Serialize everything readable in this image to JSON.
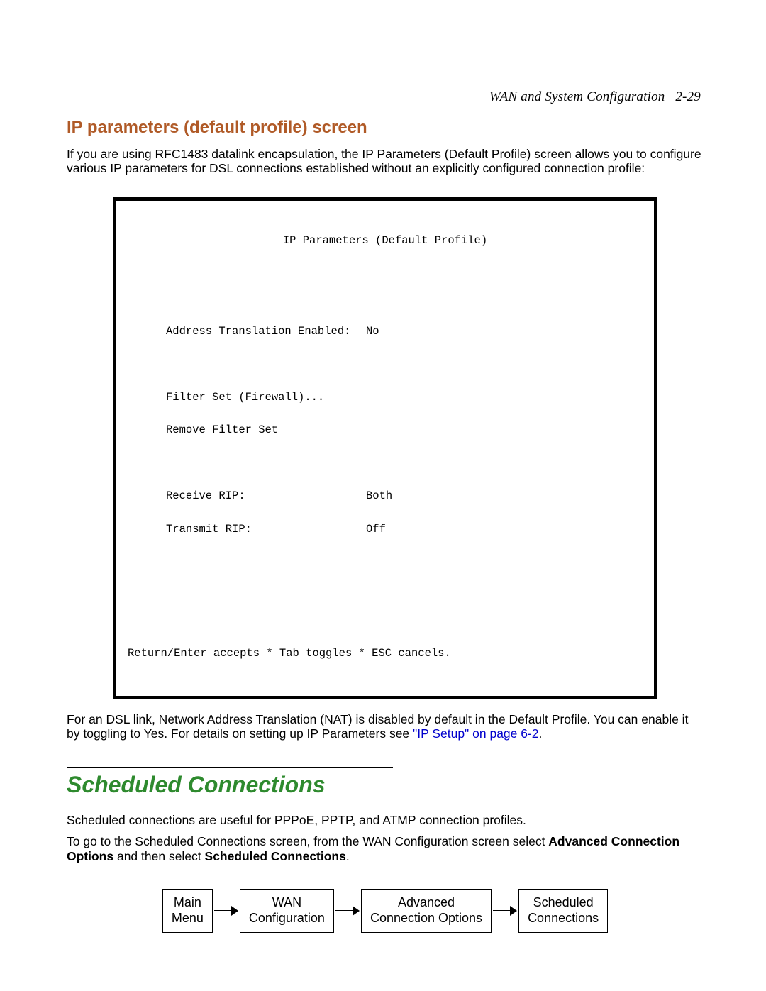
{
  "header": {
    "title": "WAN and System Configuration",
    "page_ref": "2-29"
  },
  "section1": {
    "heading": "IP parameters (default profile) screen",
    "intro": "If you are using RFC1483 datalink encapsulation, the IP Parameters (Default Profile) screen allows you to configure various IP parameters for DSL connections established without an explicitly configured connection profile:"
  },
  "terminal": {
    "title": "IP Parameters (Default Profile)",
    "rows": {
      "addr_trans_label": "Address Translation Enabled:",
      "addr_trans_value": "No",
      "filter_set": "Filter Set (Firewall)...",
      "remove_filter": "Remove Filter Set",
      "receive_rip_label": "Receive RIP:",
      "receive_rip_value": "Both",
      "transmit_rip_label": "Transmit RIP:",
      "transmit_rip_value": "Off"
    },
    "footer": "Return/Enter accepts * Tab toggles * ESC cancels."
  },
  "post_terminal": {
    "text_pre": "For an DSL link, Network Address Translation (NAT) is disabled by default in the Default Profile. You can enable it by toggling to Yes. For details on setting up IP Parameters see ",
    "link_text": "\"IP Setup\" on page 6-2",
    "text_post": "."
  },
  "section2": {
    "heading": "Scheduled Connections",
    "p1": "Scheduled connections are useful for PPPoE, PPTP, and ATMP connection profiles.",
    "p2_pre": "To go to the Scheduled Connections screen, from the WAN Configuration screen select ",
    "p2_b1": "Advanced Connection Options",
    "p2_mid": " and then select ",
    "p2_b2": "Scheduled Connections",
    "p2_post": "."
  },
  "nav": {
    "b1a": "Main",
    "b1b": "Menu",
    "b2a": "WAN",
    "b2b": "Configuration",
    "b3a": "Advanced",
    "b3b": "Connection Options",
    "b4a": "Scheduled",
    "b4b": "Connections"
  }
}
